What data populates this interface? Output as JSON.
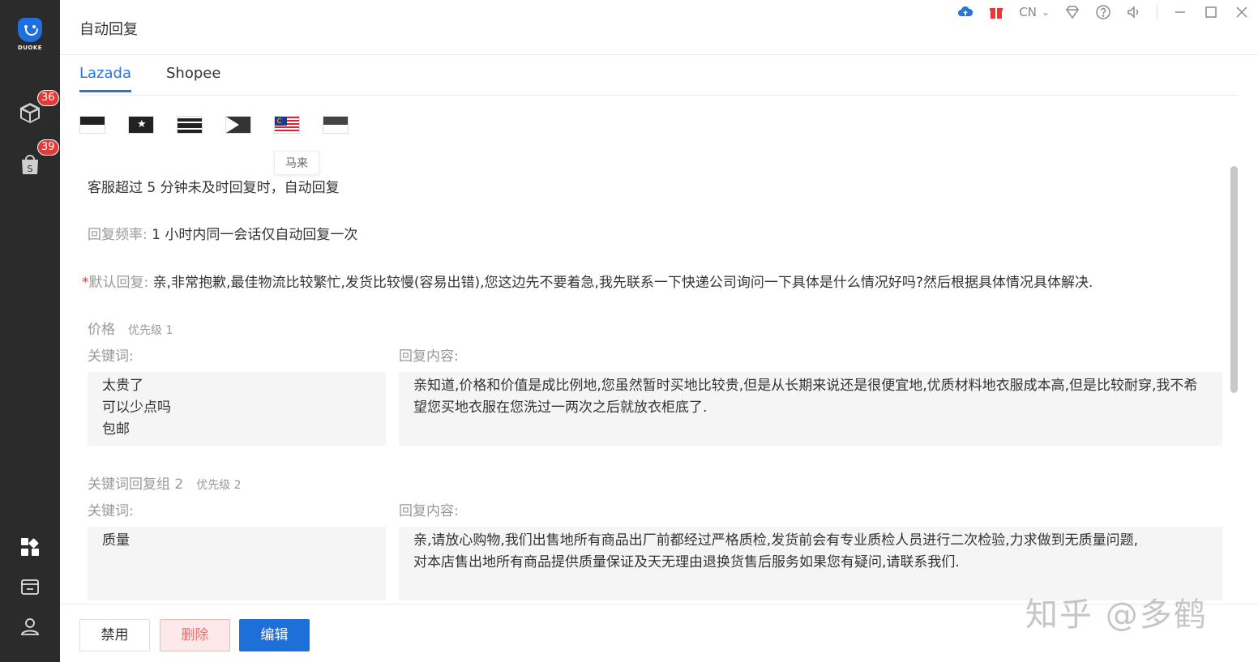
{
  "app": {
    "logo_text": "DUOKE"
  },
  "sidebar": {
    "items": [
      {
        "name": "package",
        "badge": "36"
      },
      {
        "name": "shop",
        "badge": "39"
      }
    ],
    "bottom_icons": [
      "grid-icon",
      "store-icon",
      "user-icon"
    ]
  },
  "header": {
    "title": "自动回复",
    "lang": "CN"
  },
  "tabs": [
    {
      "label": "Lazada",
      "active": true
    },
    {
      "label": "Shopee",
      "active": false
    }
  ],
  "flags": {
    "tooltip": "马来"
  },
  "rule": {
    "trigger": "客服超过 5 分钟未及时回复时，自动回复",
    "freq_label": "回复频率:",
    "freq_value": "1 小时内同一会话仅自动回复一次",
    "default_required": "*",
    "default_label": "默认回复:",
    "default_value": "亲,非常抱歉,最佳物流比较繁忙,发货比较慢(容易出错),您这边先不要着急,我先联系一下快递公司询问一下具体是什么情况好吗?然后根据具体情况具体解决."
  },
  "groups": [
    {
      "title": "价格",
      "priority": "优先级 1",
      "keywords_label": "关键词:",
      "reply_label": "回复内容:",
      "keywords": [
        "太贵了",
        "可以少点吗",
        "包邮"
      ],
      "reply": "亲知道,价格和价值是成比例地,您虽然暂时买地比较贵,但是从长期来说还是很便宜地,优质材料地衣服成本高,但是比较耐穿,我不希望您买地衣服在您洗过一两次之后就放衣柜底了."
    },
    {
      "title": "关键词回复组 2",
      "priority": "优先级 2",
      "keywords_label": "关键词:",
      "reply_label": "回复内容:",
      "keywords": [
        "质量"
      ],
      "reply_line1": "亲,请放心购物,我们出售地所有商品出厂前都经过严格质检,发货前会有专业质检人员进行二次检验,力求做到无质量问题,",
      "reply_line2": "对本店售出地所有商品提供质量保证及天无理由退换货售后服务如果您有疑问,请联系我们."
    }
  ],
  "footer": {
    "disable_label": "禁用",
    "delete_label": "删除",
    "edit_label": "编辑"
  },
  "watermark": "知乎 @多鹤",
  "colors": {
    "accent": "#2a73d8",
    "sidebar": "#2b2b2b",
    "badge": "#e53935"
  }
}
